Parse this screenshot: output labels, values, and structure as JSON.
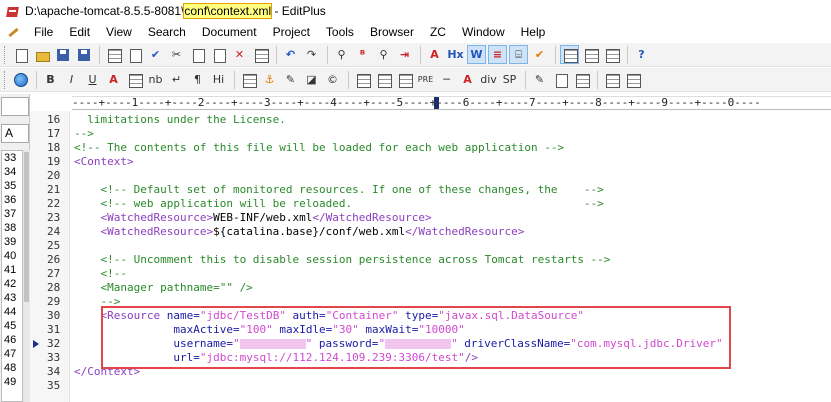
{
  "window": {
    "title_prefix": "D:\\apache-tomcat-8.5.5-8081\\",
    "title_highlight": "conf\\context.xml",
    "title_suffix": " - EditPlus"
  },
  "menu": [
    "File",
    "Edit",
    "View",
    "Search",
    "Document",
    "Project",
    "Tools",
    "Browser",
    "ZC",
    "Window",
    "Help"
  ],
  "ruler": "----+----1----+----2----+----3----+----4----+----5----+----6----+----7----+----8----+----9----+----0----",
  "side": {
    "font_combo": "",
    "size_combo": "A",
    "list": [
      "33",
      "34",
      "35",
      "36",
      "37",
      "38",
      "39",
      "40",
      "41",
      "42",
      "43",
      "44",
      "45",
      "46",
      "47",
      "48",
      "49"
    ]
  },
  "editor": {
    "lines": [
      {
        "n": "16",
        "segments": [
          {
            "c": "cm",
            "t": "  limitations under the License."
          }
        ]
      },
      {
        "n": "17",
        "segments": [
          {
            "c": "cm",
            "t": "-->"
          }
        ]
      },
      {
        "n": "18",
        "segments": [
          {
            "c": "cm",
            "t": "<!-- The contents of this file will be loaded for each web application -->"
          }
        ]
      },
      {
        "n": "19",
        "segments": [
          {
            "c": "tg",
            "t": "<Context>"
          }
        ]
      },
      {
        "n": "20",
        "segments": []
      },
      {
        "n": "21",
        "segments": [
          {
            "c": "cm",
            "t": "    <!-- Default set of monitored resources. If one of these changes, the    -->"
          }
        ]
      },
      {
        "n": "22",
        "segments": [
          {
            "c": "cm",
            "t": "    <!-- web application will be reloaded.                                   -->"
          }
        ]
      },
      {
        "n": "23",
        "segments": [
          {
            "c": "tg",
            "t": "    <WatchedResource>"
          },
          {
            "c": "tx",
            "t": "WEB-INF/web.xml"
          },
          {
            "c": "tg",
            "t": "</WatchedResource>"
          }
        ]
      },
      {
        "n": "24",
        "segments": [
          {
            "c": "tg",
            "t": "    <WatchedResource>"
          },
          {
            "c": "tx",
            "t": "${catalina.base}/conf/web.xml"
          },
          {
            "c": "tg",
            "t": "</WatchedResource>"
          }
        ]
      },
      {
        "n": "25",
        "segments": []
      },
      {
        "n": "26",
        "segments": [
          {
            "c": "cm",
            "t": "    <!-- Uncomment this to disable session persistence across Tomcat restarts -->"
          }
        ]
      },
      {
        "n": "27",
        "segments": [
          {
            "c": "cm",
            "t": "    <!--"
          }
        ]
      },
      {
        "n": "28",
        "segments": [
          {
            "c": "cm",
            "t": "    <Manager pathname=\"\" />"
          }
        ]
      },
      {
        "n": "29",
        "segments": [
          {
            "c": "cm",
            "t": "    -->"
          }
        ]
      },
      {
        "n": "30",
        "segments": [
          {
            "c": "tg",
            "t": "    <Resource "
          },
          {
            "c": "at",
            "t": "name="
          },
          {
            "c": "vl",
            "t": "\"jdbc/TestDB\""
          },
          {
            "c": "at",
            "t": " auth="
          },
          {
            "c": "vl",
            "t": "\"Container\""
          },
          {
            "c": "at",
            "t": " type="
          },
          {
            "c": "vl",
            "t": "\"javax.sql.DataSource\""
          }
        ]
      },
      {
        "n": "31",
        "segments": [
          {
            "c": "at",
            "t": "               maxActive="
          },
          {
            "c": "vl",
            "t": "\"100\""
          },
          {
            "c": "at",
            "t": " maxIdle="
          },
          {
            "c": "vl",
            "t": "\"30\""
          },
          {
            "c": "at",
            "t": " maxWait="
          },
          {
            "c": "vl",
            "t": "\"10000\""
          }
        ]
      },
      {
        "n": "32",
        "segments": [
          {
            "c": "at",
            "t": "               username="
          },
          {
            "c": "vl",
            "t": "\""
          },
          {
            "c": "redact",
            "w": 66
          },
          {
            "c": "vl",
            "t": "\""
          },
          {
            "c": "at",
            "t": " password="
          },
          {
            "c": "vl",
            "t": "\""
          },
          {
            "c": "redact",
            "w": 66
          },
          {
            "c": "vl",
            "t": "\""
          },
          {
            "c": "at",
            "t": " driverClassName="
          },
          {
            "c": "vl",
            "t": "\"com.mysql.jdbc.Driver\""
          }
        ]
      },
      {
        "n": "33",
        "segments": [
          {
            "c": "at",
            "t": "               url="
          },
          {
            "c": "vl",
            "t": "\"jdbc:mysql://112.124.109.239:3306/test\""
          },
          {
            "c": "tg",
            "t": "/>"
          }
        ]
      },
      {
        "n": "34",
        "segments": [
          {
            "c": "tg",
            "t": "</Context>"
          }
        ]
      },
      {
        "n": "35",
        "segments": []
      }
    ],
    "current_line": "32"
  },
  "colors": {
    "comment": "#2a8a2a",
    "tag": "#8b3fbf",
    "attribute": "#1a1aa6",
    "value": "#d04ad0",
    "highlight_box": "#e0464a",
    "title_highlight": "#ffff80"
  }
}
